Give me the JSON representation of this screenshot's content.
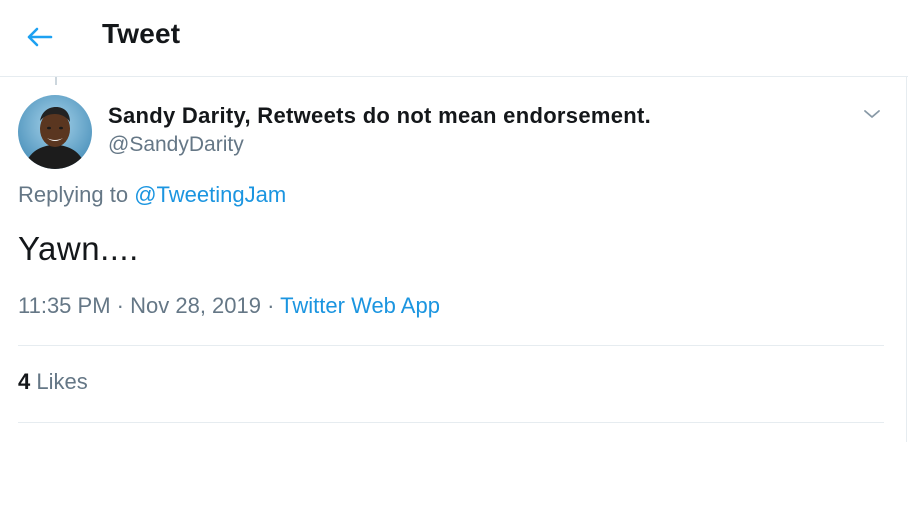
{
  "colors": {
    "accent": "#1da1f2",
    "link": "#1b95e0",
    "primary_text": "#14171a",
    "secondary_text": "#657786",
    "border": "#e6ecf0"
  },
  "header": {
    "back_icon": "arrow-left-icon",
    "title": "Tweet"
  },
  "tweet": {
    "author": {
      "display_name": "Sandy Darity, Retweets do not mean endorsement.",
      "handle": "@SandyDarity",
      "avatar_icon": "avatar"
    },
    "menu_icon": "chevron-down-icon",
    "replying_to_label": "Replying to",
    "replying_to_handle": "@TweetingJam",
    "text": "Yawn....",
    "time": "11:35 PM",
    "date": "Nov 28, 2019",
    "separator": "·",
    "source": "Twitter Web App",
    "likes_count": "4",
    "likes_label": "Likes"
  }
}
